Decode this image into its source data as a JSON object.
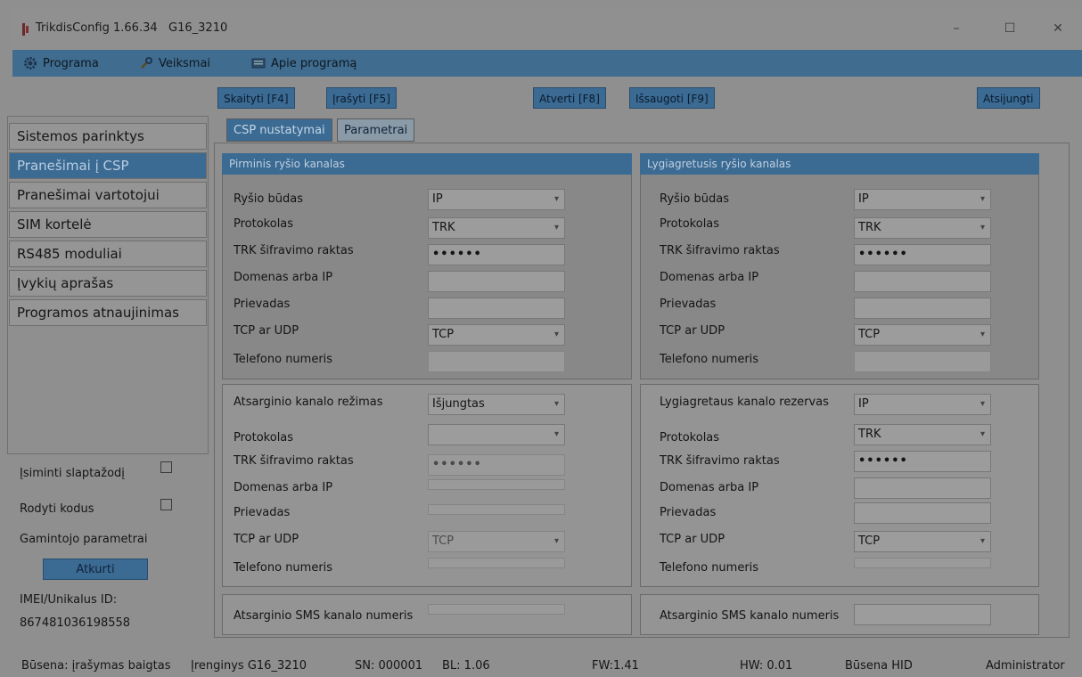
{
  "window": {
    "title": "TrikdisConfig 1.66.34",
    "device": "G16_3210",
    "controls": {
      "minimize": "–",
      "maximize": "☐",
      "close": "✕"
    }
  },
  "menu": [
    {
      "label": "Programa",
      "icon": "gear-icon"
    },
    {
      "label": "Veiksmai",
      "icon": "tools-icon"
    },
    {
      "label": "Apie programą",
      "icon": "info-icon"
    }
  ],
  "toolbar": {
    "read": "Skaityti [F4]",
    "write": "Įrašyti [F5]",
    "open": "Atverti [F8]",
    "save": "Išsaugoti [F9]",
    "disconnect": "Atsijungti"
  },
  "nav": [
    "Sistemos parinktys",
    "Pranešimai į CSP",
    "Pranešimai vartotojui",
    "SIM kortelė",
    "RS485 moduliai",
    "Įvykių aprašas",
    "Programos atnaujinimas"
  ],
  "nav_active": "Pranešimai į CSP",
  "side": {
    "remember_password": "Įsiminti slaptažodį",
    "show_codes": "Rodyti kodus",
    "factory_params": "Gamintojo parametrai",
    "restore": "Atkurti",
    "imei_label": "IMEI/Unikalus ID:",
    "imei_value": "867481036198558"
  },
  "tabs": {
    "csp": "CSP nustatymai",
    "params": "Parametrai"
  },
  "primary": {
    "title": "Pirminis ryšio kanalas",
    "mode_label": "Ryšio būdas",
    "mode": "IP",
    "protocol_label": "Protokolas",
    "protocol": "TRK",
    "key_label": "TRK šifravimo raktas",
    "key": "••••••",
    "domain_label": "Domenas arba IP",
    "domain": "",
    "port_label": "Prievadas",
    "port": "",
    "tcpudp_label": "TCP ar UDP",
    "tcpudp": "TCP",
    "phone_label": "Telefono numeris",
    "phone": ""
  },
  "parallel": {
    "title": "Lygiagretusis ryšio kanalas",
    "mode_label": "Ryšio būdas",
    "mode": "IP",
    "protocol_label": "Protokolas",
    "protocol": "TRK",
    "key_label": "TRK šifravimo raktas",
    "key": "••••••",
    "domain_label": "Domenas arba IP",
    "domain": "",
    "port_label": "Prievadas",
    "port": "",
    "tcpudp_label": "TCP ar UDP",
    "tcpudp": "TCP",
    "phone_label": "Telefono numeris",
    "phone": ""
  },
  "backup": {
    "mode_label": "Atsarginio kanalo režimas",
    "mode": "Išjungtas",
    "protocol_label": "Protokolas",
    "protocol": "",
    "key_label": "TRK šifravimo raktas",
    "key": "••••••",
    "domain_label": "Domenas arba IP",
    "port_label": "Prievadas",
    "tcpudp_label": "TCP ar UDP",
    "tcpudp": "TCP",
    "phone_label": "Telefono numeris",
    "sms_label": "Atsarginio SMS kanalo numeris"
  },
  "parallel_backup": {
    "mode_label": "Lygiagretaus kanalo rezervas",
    "mode": "IP",
    "protocol_label": "Protokolas",
    "protocol": "TRK",
    "key_label": "TRK šifravimo raktas",
    "key": "••••••",
    "domain_label": "Domenas arba IP",
    "port_label": "Prievadas",
    "tcpudp_label": "TCP ar UDP",
    "tcpudp": "TCP",
    "phone_label": "Telefono numeris",
    "sms_label": "Atsarginio SMS kanalo numeris"
  },
  "status": {
    "state": "Būsena: įrašymas baigtas",
    "device": "Įrenginys G16_3210",
    "sn": "SN: 000001",
    "bl": "BL: 1.06",
    "fw": "FW:1.41",
    "hw": "HW: 0.01",
    "mode": "Būsena HID",
    "user": "Administrator"
  }
}
